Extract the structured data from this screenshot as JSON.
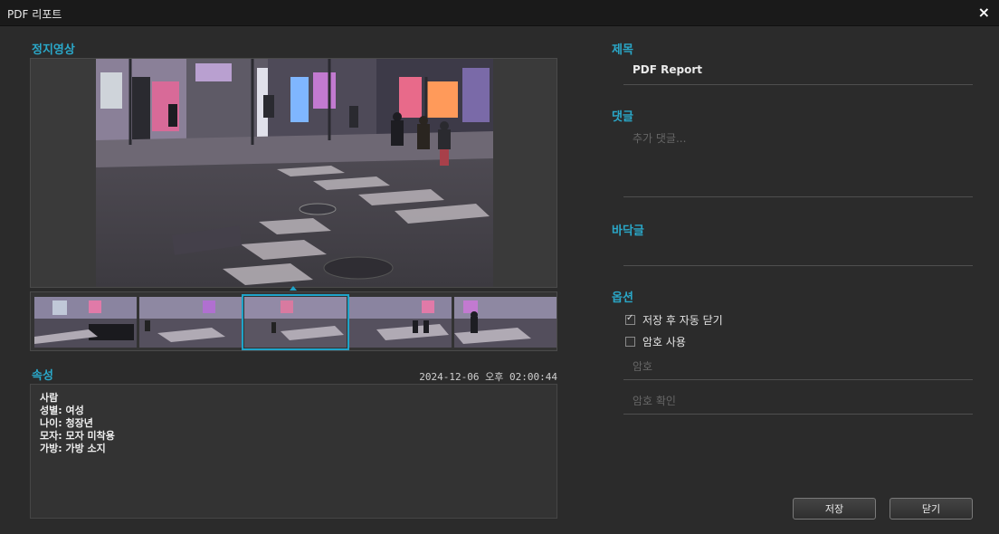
{
  "window": {
    "title": "PDF 리포트",
    "close_icon": "×"
  },
  "left": {
    "still_image_label": "정지영상",
    "attributes_label": "속성",
    "timestamp": "2024-12-06 오후 02:00:44",
    "attributes": [
      "사람",
      "성별: 여성",
      "나이: 청장년",
      "모자: 모자 미착용",
      "가방: 가방 소지"
    ],
    "selected_thumbnail": 3
  },
  "right": {
    "title_label": "제목",
    "title_value": "PDF Report",
    "comment_label": "댓글",
    "comment_placeholder": "추가 댓글...",
    "footer_label": "바닥글",
    "options_label": "옵션",
    "options": [
      {
        "label": "저장 후 자동 닫기",
        "checked": true
      },
      {
        "label": "암호 사용",
        "checked": false
      }
    ],
    "password_placeholder": "암호",
    "password_confirm_placeholder": "암호 확인"
  },
  "buttons": {
    "save": "저장",
    "close": "닫기"
  },
  "colors": {
    "accent": "#2aa8c9",
    "background": "#2b2b2b",
    "titlebar": "#1a1a1a"
  }
}
